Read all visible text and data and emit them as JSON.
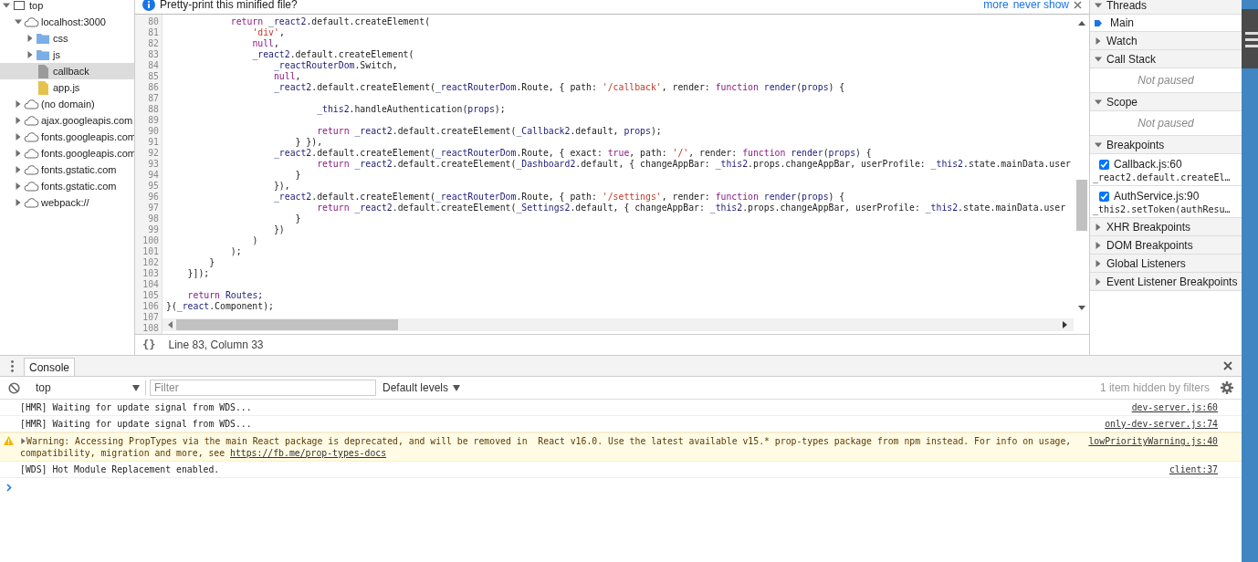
{
  "navigator": {
    "tree": [
      {
        "label": "top",
        "kind": "frame",
        "expanded": true,
        "selected": false,
        "children": [
          {
            "label": "localhost:3000",
            "kind": "domain",
            "expanded": true,
            "selected": false,
            "children": [
              {
                "label": "css",
                "kind": "folder",
                "expanded": false,
                "selected": false
              },
              {
                "label": "js",
                "kind": "folder",
                "expanded": false,
                "selected": false
              },
              {
                "label": "callback",
                "kind": "document",
                "selected": true
              },
              {
                "label": "app.js",
                "kind": "script",
                "selected": false
              }
            ]
          },
          {
            "label": "(no domain)",
            "kind": "domain",
            "expanded": false,
            "selected": false
          },
          {
            "label": "ajax.googleapis.com",
            "kind": "domain",
            "expanded": false,
            "selected": false
          },
          {
            "label": "fonts.googleapis.com",
            "kind": "domain",
            "expanded": false,
            "selected": false
          },
          {
            "label": "fonts.googleapis.com",
            "kind": "domain",
            "expanded": false,
            "selected": false
          },
          {
            "label": "fonts.gstatic.com",
            "kind": "domain",
            "expanded": false,
            "selected": false
          },
          {
            "label": "fonts.gstatic.com",
            "kind": "domain",
            "expanded": false,
            "selected": false
          },
          {
            "label": "webpack://",
            "kind": "domain",
            "expanded": false,
            "selected": false
          }
        ]
      }
    ]
  },
  "editor": {
    "infobar": {
      "message": "Pretty-print this minified file?",
      "links": [
        "more",
        "never show"
      ]
    },
    "lines": [
      {
        "number": "80",
        "tokens": [
          {
            "kind": "keyword",
            "text": "            return "
          },
          {
            "kind": "variable",
            "text": "_react2"
          },
          {
            "kind": "plain",
            "text": ".default.createElement("
          }
        ]
      },
      {
        "number": "81",
        "tokens": [
          {
            "kind": "string",
            "text": "                'div'"
          },
          {
            "kind": "plain",
            "text": ","
          }
        ]
      },
      {
        "number": "82",
        "tokens": [
          {
            "kind": "keyword",
            "text": "                null"
          },
          {
            "kind": "plain",
            "text": ","
          }
        ]
      },
      {
        "number": "83",
        "tokens": [
          {
            "kind": "variable",
            "text": "                _react2"
          },
          {
            "kind": "plain",
            "text": ".default.createElement("
          }
        ]
      },
      {
        "number": "84",
        "tokens": [
          {
            "kind": "variable",
            "text": "                    _reactRouterDom"
          },
          {
            "kind": "plain",
            "text": ".Switch,"
          }
        ]
      },
      {
        "number": "85",
        "tokens": [
          {
            "kind": "keyword",
            "text": "                    null"
          },
          {
            "kind": "plain",
            "text": ","
          }
        ]
      },
      {
        "number": "86",
        "tokens": [
          {
            "kind": "variable",
            "text": "                    _react2"
          },
          {
            "kind": "plain",
            "text": ".default.createElement("
          },
          {
            "kind": "variable",
            "text": "_reactRouterDom"
          },
          {
            "kind": "plain",
            "text": ".Route, { path: "
          },
          {
            "kind": "string",
            "text": "'/callback'"
          },
          {
            "kind": "plain",
            "text": ", render: "
          },
          {
            "kind": "keyword",
            "text": "function "
          },
          {
            "kind": "variable",
            "text": "render"
          },
          {
            "kind": "plain",
            "text": "("
          },
          {
            "kind": "variable",
            "text": "props"
          },
          {
            "kind": "plain",
            "text": ") {"
          }
        ]
      },
      {
        "number": "87"
      },
      {
        "number": "88",
        "tokens": [
          {
            "kind": "variable",
            "text": "                            _this2"
          },
          {
            "kind": "plain",
            "text": ".handleAuthentication("
          },
          {
            "kind": "variable",
            "text": "props"
          },
          {
            "kind": "plain",
            "text": ");"
          }
        ]
      },
      {
        "number": "89"
      },
      {
        "number": "90",
        "tokens": [
          {
            "kind": "keyword",
            "text": "                            return "
          },
          {
            "kind": "variable",
            "text": "_react2"
          },
          {
            "kind": "plain",
            "text": ".default.createElement("
          },
          {
            "kind": "variable",
            "text": "_Callback2"
          },
          {
            "kind": "plain",
            "text": ".default, "
          },
          {
            "kind": "variable",
            "text": "props"
          },
          {
            "kind": "plain",
            "text": ");"
          }
        ]
      },
      {
        "number": "91",
        "tokens": [
          {
            "kind": "plain",
            "text": "                        } }),"
          }
        ]
      },
      {
        "number": "92",
        "tokens": [
          {
            "kind": "variable",
            "text": "                    _react2"
          },
          {
            "kind": "plain",
            "text": ".default.createElement("
          },
          {
            "kind": "variable",
            "text": "_reactRouterDom"
          },
          {
            "kind": "plain",
            "text": ".Route, { exact: "
          },
          {
            "kind": "keyword",
            "text": "true"
          },
          {
            "kind": "plain",
            "text": ", path: "
          },
          {
            "kind": "string",
            "text": "'/'"
          },
          {
            "kind": "plain",
            "text": ", render: "
          },
          {
            "kind": "keyword",
            "text": "function "
          },
          {
            "kind": "variable",
            "text": "render"
          },
          {
            "kind": "plain",
            "text": "("
          },
          {
            "kind": "variable",
            "text": "props"
          },
          {
            "kind": "plain",
            "text": ") {"
          }
        ]
      },
      {
        "number": "93",
        "tokens": [
          {
            "kind": "keyword",
            "text": "                            return "
          },
          {
            "kind": "variable",
            "text": "_react2"
          },
          {
            "kind": "plain",
            "text": ".default.createElement("
          },
          {
            "kind": "variable",
            "text": "_Dashboard2"
          },
          {
            "kind": "plain",
            "text": ".default, { changeAppBar: "
          },
          {
            "kind": "variable",
            "text": "_this2"
          },
          {
            "kind": "plain",
            "text": ".props.changeAppBar, userProfile: "
          },
          {
            "kind": "variable",
            "text": "_this2"
          },
          {
            "kind": "plain",
            "text": ".state.mainData.user"
          }
        ]
      },
      {
        "number": "94",
        "tokens": [
          {
            "kind": "plain",
            "text": "                        }"
          }
        ]
      },
      {
        "number": "95",
        "tokens": [
          {
            "kind": "plain",
            "text": "                    }),"
          }
        ]
      },
      {
        "number": "96",
        "tokens": [
          {
            "kind": "variable",
            "text": "                    _react2"
          },
          {
            "kind": "plain",
            "text": ".default.createElement("
          },
          {
            "kind": "variable",
            "text": "_reactRouterDom"
          },
          {
            "kind": "plain",
            "text": ".Route, { path: "
          },
          {
            "kind": "string",
            "text": "'/settings'"
          },
          {
            "kind": "plain",
            "text": ", render: "
          },
          {
            "kind": "keyword",
            "text": "function "
          },
          {
            "kind": "variable",
            "text": "render"
          },
          {
            "kind": "plain",
            "text": "("
          },
          {
            "kind": "variable",
            "text": "props"
          },
          {
            "kind": "plain",
            "text": ") {"
          }
        ]
      },
      {
        "number": "97",
        "tokens": [
          {
            "kind": "keyword",
            "text": "                            return "
          },
          {
            "kind": "variable",
            "text": "_react2"
          },
          {
            "kind": "plain",
            "text": ".default.createElement("
          },
          {
            "kind": "variable",
            "text": "_Settings2"
          },
          {
            "kind": "plain",
            "text": ".default, { changeAppBar: "
          },
          {
            "kind": "variable",
            "text": "_this2"
          },
          {
            "kind": "plain",
            "text": ".props.changeAppBar, userProfile: "
          },
          {
            "kind": "variable",
            "text": "_this2"
          },
          {
            "kind": "plain",
            "text": ".state.mainData.user"
          }
        ]
      },
      {
        "number": "98",
        "tokens": [
          {
            "kind": "plain",
            "text": "                        }"
          }
        ]
      },
      {
        "number": "99",
        "tokens": [
          {
            "kind": "plain",
            "text": "                    })"
          }
        ]
      },
      {
        "number": "100",
        "tokens": [
          {
            "kind": "plain",
            "text": "                )"
          }
        ]
      },
      {
        "number": "101",
        "tokens": [
          {
            "kind": "plain",
            "text": "            );"
          }
        ]
      },
      {
        "number": "102",
        "tokens": [
          {
            "kind": "plain",
            "text": "        }"
          }
        ]
      },
      {
        "number": "103",
        "tokens": [
          {
            "kind": "plain",
            "text": "    }]);"
          }
        ]
      },
      {
        "number": "104"
      },
      {
        "number": "105",
        "tokens": [
          {
            "kind": "keyword",
            "text": "    return "
          },
          {
            "kind": "variable",
            "text": "Routes"
          },
          {
            "kind": "plain",
            "text": ";"
          }
        ]
      },
      {
        "number": "106",
        "tokens": [
          {
            "kind": "plain",
            "text": "}("
          },
          {
            "kind": "variable",
            "text": "_react"
          },
          {
            "kind": "plain",
            "text": ".Component);"
          }
        ]
      },
      {
        "number": "107"
      },
      {
        "number": "108"
      }
    ],
    "status": {
      "format_button": "{}",
      "position": "Line 83, Column 33"
    }
  },
  "sidebar": {
    "sections": [
      {
        "title": "Threads",
        "expanded": true,
        "threads": [
          {
            "label": "Main",
            "selected": true
          }
        ]
      },
      {
        "title": "Watch",
        "expanded": false
      },
      {
        "title": "Call Stack",
        "expanded": true,
        "message": "Not paused"
      },
      {
        "title": "Scope",
        "expanded": true,
        "message": "Not paused"
      },
      {
        "title": "Breakpoints",
        "expanded": true,
        "breakpoints": [
          {
            "location": "Callback.js:60",
            "code": "_react2.default.createEl…",
            "checked": true
          },
          {
            "location": "AuthService.js:90",
            "code": "_this2.setToken(authResu…",
            "checked": true
          }
        ]
      },
      {
        "title": "XHR Breakpoints",
        "expanded": false
      },
      {
        "title": "DOM Breakpoints",
        "expanded": false
      },
      {
        "title": "Global Listeners",
        "expanded": false
      },
      {
        "title": "Event Listener Breakpoints",
        "expanded": false
      }
    ]
  },
  "console": {
    "tabs": [
      {
        "label": "Console",
        "selected": true
      }
    ],
    "context": "top",
    "filter": {
      "placeholder": "Filter"
    },
    "levels": "Default levels",
    "hidden_note": "1 item hidden by filters",
    "messages": [
      {
        "kind": "log",
        "text": "[HMR] Waiting for update signal from WDS...",
        "source": "dev-server.js:60"
      },
      {
        "kind": "log",
        "text": "[HMR] Waiting for update signal from WDS...",
        "source": "only-dev-server.js:74"
      },
      {
        "kind": "warning",
        "expanded": false,
        "text": "Warning: Accessing PropTypes via the main React package is deprecated, and will be removed in  React v16.0. Use the latest available v15.* prop-types package from npm instead. For info on usage, compatibility, migration and more, see ",
        "link": "https://fb.me/prop-types-docs",
        "source": "lowPriorityWarning.js:40"
      },
      {
        "kind": "log",
        "text": "[WDS] Hot Module Replacement enabled.",
        "source": "client:37"
      }
    ]
  }
}
